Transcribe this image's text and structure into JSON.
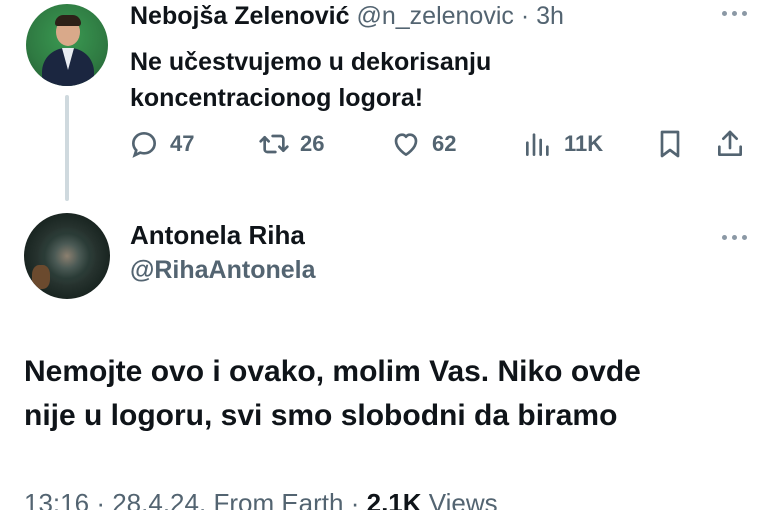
{
  "original_tweet": {
    "author_name": "Nebojša Zelenović",
    "author_handle": "@n_zelenovic",
    "separator": "·",
    "time_ago": "3h",
    "text_line1": "Ne učestvujemo u dekorisanju",
    "text_line2": "koncentracionog logora!",
    "stats": {
      "replies": "47",
      "reposts": "26",
      "likes": "62",
      "views": "11K"
    }
  },
  "reply_tweet": {
    "author_name": "Antonela Riha",
    "author_handle": "@RihaAntonela",
    "text_line1": "Nemojte ovo i ovako, molim Vas. Niko ovde",
    "text_line2": "nije u logoru, svi smo slobodni da biramo",
    "time": "13:16",
    "date": "28.4.24.",
    "source": "From Earth",
    "views_count": "2,1K",
    "views_label": "Views",
    "separator": "·"
  },
  "icons": {
    "reply": "reply-icon",
    "repost": "repost-icon",
    "like": "heart-icon",
    "views": "views-icon",
    "bookmark": "bookmark-icon",
    "share": "share-icon",
    "more": "more-icon"
  },
  "colors": {
    "text": "#0f1419",
    "muted": "#536471",
    "thread_line": "#cfd9de"
  }
}
